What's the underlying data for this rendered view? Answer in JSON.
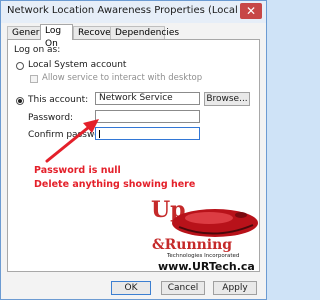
{
  "window": {
    "title": "Network Location Awareness Properties (Local Compu",
    "close_glyph": "✕"
  },
  "tabs": [
    {
      "label": "General"
    },
    {
      "label": "Log On"
    },
    {
      "label": "Recovery"
    },
    {
      "label": "Dependencies"
    }
  ],
  "logon": {
    "heading": "Log on as:",
    "local_system_label": "Local System account",
    "allow_interact_label": "Allow service to interact with desktop",
    "this_account_label": "This account:",
    "account_value": "Network Service",
    "browse_label": "Browse...",
    "password_label": "Password:",
    "password_value": "",
    "confirm_label": "Confirm password:",
    "confirm_value": "",
    "selected_option": "this_account"
  },
  "annotation": {
    "line1": "Password is null",
    "line2": "Delete anything showing here",
    "color": "#e4202a"
  },
  "logo": {
    "up": "Up",
    "amp_running": "&Running",
    "tagline": "Technologies Incorporated",
    "url": "www.URTech.ca"
  },
  "buttons": {
    "ok": "OK",
    "cancel": "Cancel",
    "apply": "Apply"
  }
}
